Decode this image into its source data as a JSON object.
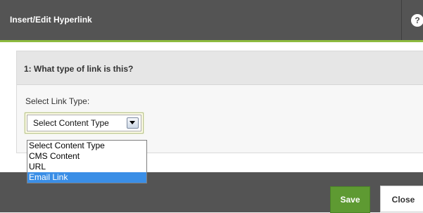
{
  "dialog": {
    "title": "Insert/Edit Hyperlink",
    "help_symbol": "?"
  },
  "step": {
    "header": "1: What type of link is this?",
    "field_label": "Select Link Type:"
  },
  "link_type_select": {
    "selected": "Select Content Type",
    "options": [
      "Select Content Type",
      "CMS Content",
      "URL",
      "Email Link"
    ],
    "highlighted_option": "Email Link"
  },
  "footer": {
    "save_label": "Save",
    "close_label": "Close"
  },
  "colors": {
    "titlebar": "#545454",
    "accent": "#8dbb3f",
    "save_button": "#5e9a32",
    "highlight": "#3a8ee6"
  }
}
